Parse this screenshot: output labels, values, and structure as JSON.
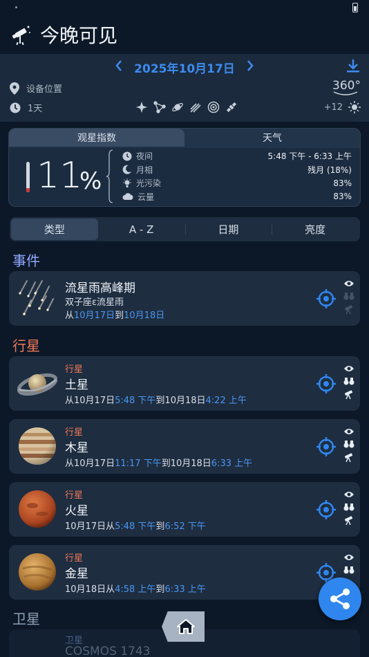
{
  "header": {
    "title": "今晚可见"
  },
  "nav": {
    "date": "2025年10月17日",
    "location": "设备位置",
    "duration": "1天",
    "view_mode": "360°",
    "magnitude": "+12"
  },
  "index_card": {
    "tabs": [
      {
        "label": "观星指数"
      },
      {
        "label": "天气"
      }
    ],
    "percent": "11",
    "percent_sign": "%",
    "rows": [
      {
        "label": "夜间",
        "value": "5:48 下午 - 6:33 上午",
        "icon": "clock-icon"
      },
      {
        "label": "月相",
        "value": "残月 (18%)",
        "icon": "moon-icon"
      },
      {
        "label": "光污染",
        "value": "83%",
        "icon": "bulb-icon"
      },
      {
        "label": "云量",
        "value": "83%",
        "icon": "cloud-icon"
      }
    ]
  },
  "sort_tabs": [
    {
      "label": "类型"
    },
    {
      "label": "A - Z"
    },
    {
      "label": "日期"
    },
    {
      "label": "亮度"
    }
  ],
  "sections": {
    "events": "事件",
    "planets": "行星",
    "moons": "卫星"
  },
  "event": {
    "name": "流星雨高峰期",
    "subtitle": "双子座ε流星雨",
    "t": [
      "从",
      "10月17日",
      "到",
      "10月18日"
    ]
  },
  "planets": [
    {
      "category": "行星",
      "name": "土星",
      "t": [
        "从10月17日",
        "5:48 下午",
        "到10月18日",
        "4:22 上午"
      ]
    },
    {
      "category": "行星",
      "name": "木星",
      "t": [
        "从10月17日",
        "11:17 下午",
        "到10月18日",
        "6:33 上午"
      ]
    },
    {
      "category": "行星",
      "name": "火星",
      "t": [
        "10月17日从",
        "5:48 下午",
        "到",
        "6:52 下午"
      ]
    },
    {
      "category": "行星",
      "name": "金星",
      "t": [
        "10月18日从",
        "4:58 上午",
        "到",
        "6:33 上午"
      ]
    }
  ],
  "moon_preview": {
    "category": "卫星",
    "name": "COSMOS 1743"
  }
}
